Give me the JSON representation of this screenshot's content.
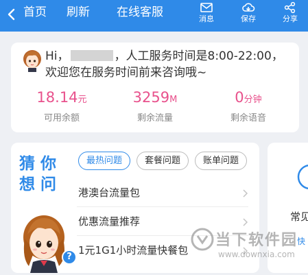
{
  "header": {
    "back_label": "首页",
    "refresh_label": "刷新",
    "service_label": "在线客服",
    "actions": {
      "message": {
        "label": "消息",
        "icon": "mail-icon"
      },
      "save": {
        "label": "保存",
        "icon": "cloud-save-icon"
      },
      "share": {
        "label": "分享",
        "icon": "share-icon"
      }
    },
    "bg_color": "#2f8ae8"
  },
  "info": {
    "greeting_prefix": "Hi，",
    "greeting_suffix": "，人工服务时间是8:00-22:00，",
    "greeting_line2": "欢迎您在服务时间前来咨询哦~",
    "stats": [
      {
        "value": "18.14",
        "unit": "元",
        "caption": "可用余额"
      },
      {
        "value": "3259",
        "unit": "M",
        "caption": "剩余流量"
      },
      {
        "value": "0",
        "unit": "分钟",
        "caption": "剩余语音"
      }
    ],
    "accent_color": "#e8518c"
  },
  "guess": {
    "title": "猜你想问",
    "tabs": [
      {
        "label": "最热问题",
        "active": true
      },
      {
        "label": "套餐问题",
        "active": false
      },
      {
        "label": "账单问题",
        "active": false
      }
    ],
    "questions": [
      {
        "label": "港澳台流量包"
      },
      {
        "label": "优惠流量推荐"
      },
      {
        "label": "1元1G1小时流量快餐包"
      }
    ],
    "help_badge": "?"
  },
  "side": {
    "label": "常见",
    "link": "快"
  },
  "watermark": {
    "title": "当下软件园",
    "url": "www.downxia.com"
  }
}
